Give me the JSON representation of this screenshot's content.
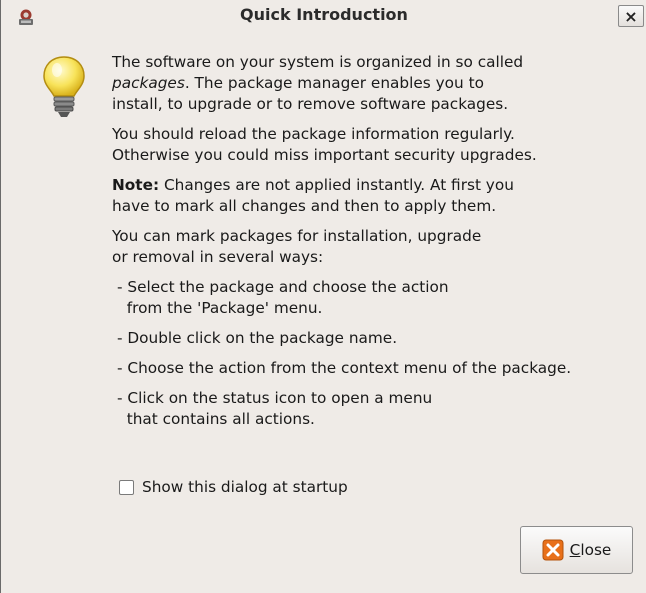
{
  "window": {
    "title": "Quick Introduction",
    "close_glyph": "×",
    "app_icon": "synaptic-icon"
  },
  "dialog_icon": "lightbulb-icon",
  "content": {
    "p1_prefix": "The software on your system is organized in so called",
    "p1_italic": "packages",
    "p1_suffix": ". The package manager enables you to",
    "p1_line3": "install, to upgrade or to remove software packages.",
    "p2_line1": "You should reload the package information regularly.",
    "p2_line2": "Otherwise you could miss important security upgrades.",
    "note_label": "Note:",
    "note_line1": " Changes are not applied instantly. At first you",
    "note_line2": "have to mark all changes and then to apply them.",
    "p4_line1": "You can mark packages for installation, upgrade",
    "p4_line2": "or removal in several ways:",
    "items": [
      {
        "line1": "- Select the package and choose the action",
        "line2": "  from the 'Package' menu."
      },
      {
        "line1": "- Double click on the package name.",
        "line2": ""
      },
      {
        "line1": "- Choose the action from the context menu of the package.",
        "line2": ""
      },
      {
        "line1": "- Click on the status icon to open a menu",
        "line2": "  that contains all actions."
      }
    ]
  },
  "checkbox": {
    "label": "Show this dialog at startup",
    "checked": false
  },
  "close_button": {
    "mnemonic": "C",
    "label_rest": "lose",
    "icon": "close-icon",
    "icon_color": "#e8701a"
  }
}
